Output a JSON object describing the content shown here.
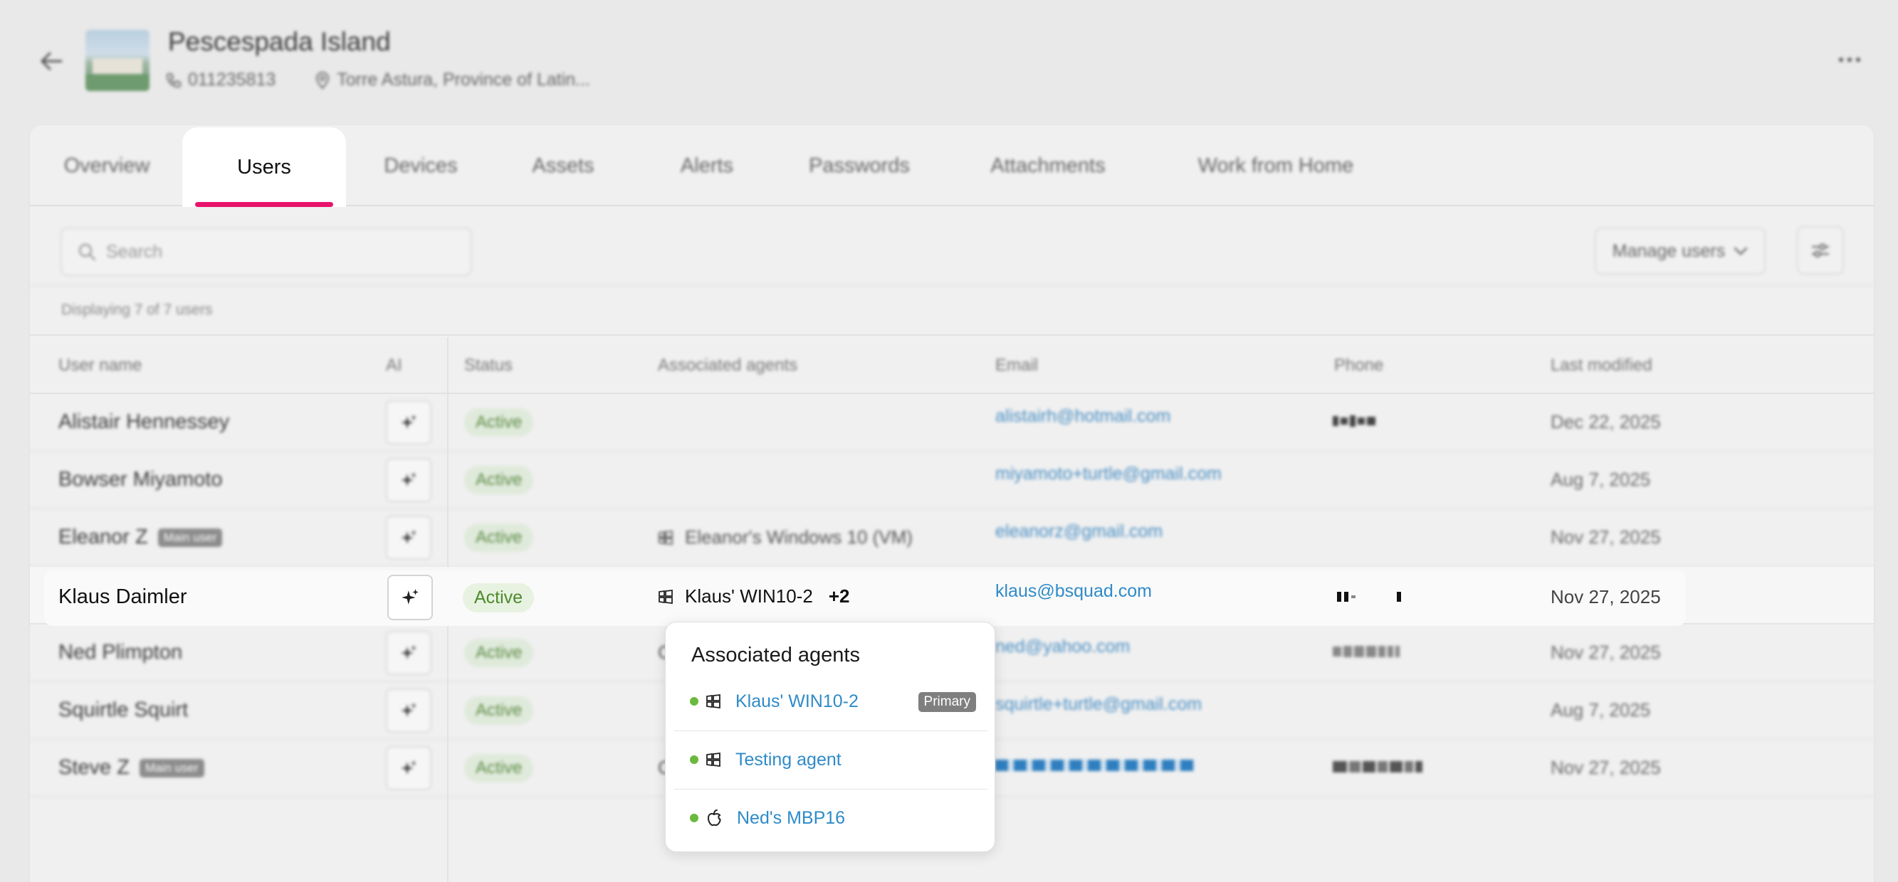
{
  "site": {
    "name": "Pescespada Island",
    "phone": "011235813",
    "address": "Torre Astura, Province of Latin..."
  },
  "tabs": [
    {
      "label": "Overview"
    },
    {
      "label": "Users"
    },
    {
      "label": "Devices"
    },
    {
      "label": "Assets"
    },
    {
      "label": "Alerts"
    },
    {
      "label": "Passwords"
    },
    {
      "label": "Attachments"
    },
    {
      "label": "Work from Home"
    }
  ],
  "active_tab": "Users",
  "search": {
    "placeholder": "Search"
  },
  "toolbar": {
    "manage_users_label": "Manage users"
  },
  "displaying_text": "Displaying 7 of 7 users",
  "columns": {
    "user_name": "User name",
    "ai": "AI",
    "status": "Status",
    "agents": "Associated agents",
    "email": "Email",
    "phone": "Phone",
    "last_modified": "Last modified"
  },
  "rows": [
    {
      "name": "Alistair Hennessey",
      "status": "Active",
      "agent": "",
      "email": "alistairh@hotmail.com",
      "last_modified": "Dec 22, 2025"
    },
    {
      "name": "Bowser Miyamoto",
      "status": "Active",
      "agent": "",
      "email": "miyamoto+turtle@gmail.com",
      "last_modified": "Aug 7, 2025"
    },
    {
      "name": "Eleanor Z",
      "badge": "Main user",
      "status": "Active",
      "agent": "Eleanor's Windows 10 (VM)",
      "email": "eleanorz@gmail.com",
      "last_modified": "Nov 27, 2025"
    },
    {
      "name": "Klaus Daimler",
      "status": "Active",
      "agent": "Klaus' WIN10-2",
      "agent_more": "+2",
      "email": "klaus@bsquad.com",
      "last_modified": "Nov 27, 2025"
    },
    {
      "name": "Ned Plimpton",
      "status": "Active",
      "agent": "C",
      "email": "ned@yahoo.com",
      "last_modified": "Nov 27, 2025"
    },
    {
      "name": "Squirtle Squirt",
      "status": "Active",
      "agent": "",
      "email": "squirtle+turtle@gmail.com",
      "last_modified": "Aug 7, 2025"
    },
    {
      "name": "Steve Z",
      "badge": "Main user",
      "status": "Active",
      "agent": "C",
      "email": "",
      "last_modified": "Nov 27, 2025"
    }
  ],
  "popover": {
    "title": "Associated agents",
    "items": [
      {
        "name": "Klaus' WIN10-2",
        "os_icon": "windows-icon",
        "badge": "Primary"
      },
      {
        "name": "Testing agent",
        "os_icon": "windows-icon"
      },
      {
        "name": "Ned's MBP16",
        "os_icon": "apple-icon"
      }
    ]
  },
  "colors": {
    "accent_tab": "#e8146c",
    "link": "#2f8bc8",
    "status_green": "#4c8a2c",
    "online_dot": "#6bb83e"
  }
}
